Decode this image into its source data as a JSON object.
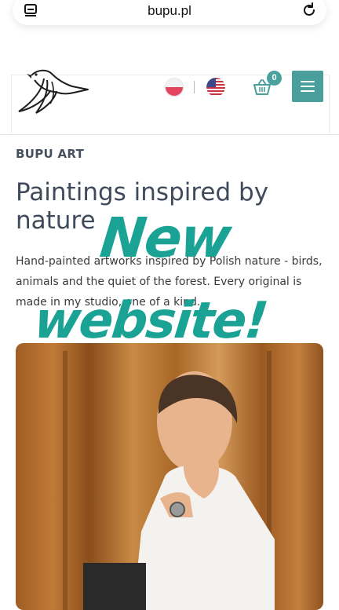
{
  "browser": {
    "url": "bupu.pl",
    "tabs_icon": "tabs-icon",
    "reload_icon": "reload-icon"
  },
  "header": {
    "logo_icon": "bird-logo-icon",
    "languages": [
      {
        "code": "pl",
        "icon": "poland-flag-icon"
      },
      {
        "code": "en",
        "icon": "usa-flag-icon"
      }
    ],
    "cart_count": "0",
    "cart_icon": "basket-icon",
    "menu_icon": "hamburger-menu-icon",
    "accent_color": "#4a9e9b"
  },
  "hero": {
    "kicker": "BUPU ART",
    "title": "Paintings inspired by nature",
    "description": "Hand-painted artworks inspired by Polish nature - birds, animals and the quiet of the forest. Every original is made in my studio, one of a kind."
  },
  "overlay": {
    "line1": "New",
    "line2": "website!",
    "color": "#1aa394"
  }
}
